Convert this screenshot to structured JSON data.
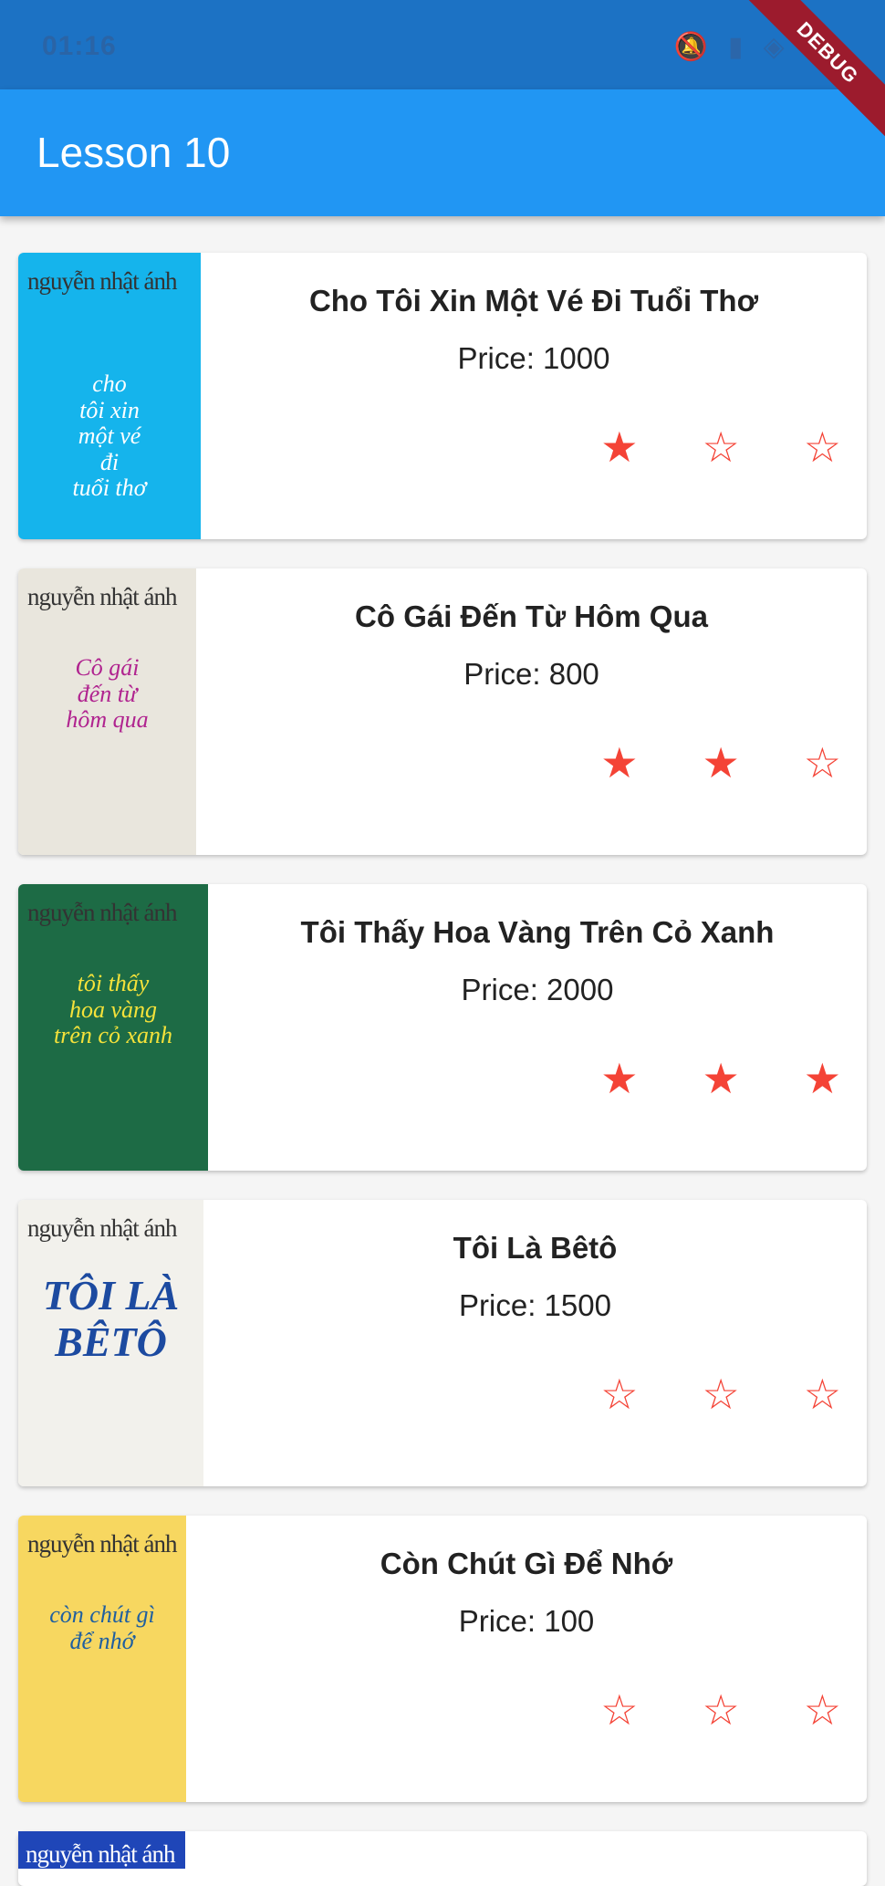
{
  "status_bar": {
    "time": "01:16",
    "icons": [
      "mute-icon",
      "signal-icon",
      "wifi-icon",
      "battery-icon"
    ]
  },
  "app_bar": {
    "title": "Lesson 10"
  },
  "debug_banner": "DEBUG",
  "colors": {
    "primary": "#2196f3",
    "status_bar": "#1c72c4",
    "star": "#f44336"
  },
  "books": [
    {
      "title": "Cho Tôi Xin Một Vé Đi Tuổi Thơ",
      "price": "Price: 1000",
      "rating": 1,
      "cover": {
        "author": "nguyễn nhật ánh",
        "title": "cho\ntôi xin\nmột vé\nđi\ntuổi thơ",
        "bg": "#15b4ec",
        "color": "#ffffff",
        "width": 200
      }
    },
    {
      "title": "Cô Gái Đến Từ Hôm Qua",
      "price": "Price: 800",
      "rating": 2,
      "cover": {
        "author": "nguyễn nhật ánh",
        "title": "Cô gái\nđến từ\nhôm qua",
        "bg": "#e9e6dd",
        "color": "#b0238f",
        "width": 195
      }
    },
    {
      "title": "Tôi Thấy Hoa Vàng Trên Cỏ Xanh",
      "price": "Price: 2000",
      "rating": 3,
      "cover": {
        "author": "nguyễn nhật ánh",
        "title": "tôi thấy\nhoa vàng\ntrên cỏ xanh",
        "bg": "#1d6b45",
        "color": "#f5e23a",
        "width": 208
      }
    },
    {
      "title": "Tôi Là Bêtô",
      "price": "Price: 1500",
      "rating": 0,
      "cover": {
        "author": "nguyễn nhật ánh",
        "title": "TÔI LÀ\nBÊTÔ",
        "bg": "#f2f1ec",
        "color": "#1c4aa0",
        "width": 203
      }
    },
    {
      "title": "Còn Chút Gì Để Nhớ",
      "price": "Price: 100",
      "rating": 0,
      "cover": {
        "author": "nguyễn nhật ánh",
        "title": "còn chút gì\nđể nhớ",
        "bg": "#f7d760",
        "color": "#1f5fa0",
        "width": 184
      }
    }
  ],
  "partial_book": {
    "cover_author": "nguyễn nhật ánh"
  }
}
